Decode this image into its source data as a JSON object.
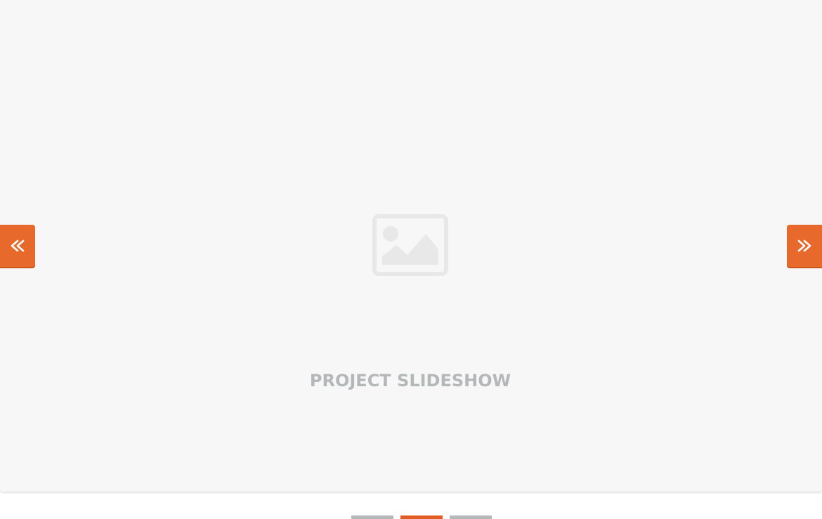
{
  "slideshow": {
    "title": "PROJECT SLIDESHOW",
    "current_slide": 2,
    "total_slides": 3,
    "prev_icon": "double-chevron-left-icon",
    "next_icon": "double-chevron-right-icon",
    "placeholder_icon": "image-placeholder-icon"
  },
  "colors": {
    "accent": "#e8692c",
    "active_indicator": "#e25d23",
    "muted": "#b4b8b8",
    "slide_background": "#f7f7f7"
  }
}
